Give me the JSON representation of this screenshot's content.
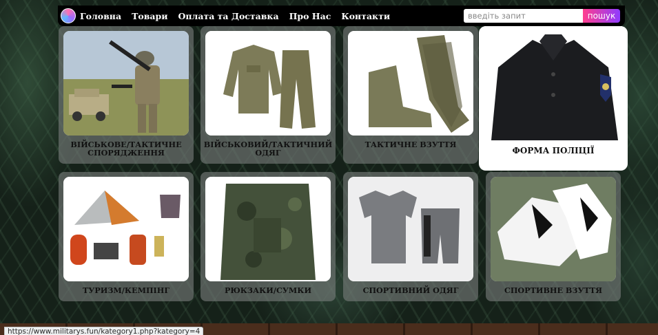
{
  "nav": {
    "links": [
      "Головна",
      "Товари",
      "Оплата та Доставка",
      "Про Нас",
      "Контакти"
    ],
    "search_placeholder": "введіть запит",
    "search_button": "пошук"
  },
  "categories": [
    {
      "title": "ВІЙСЬКОВЕ/ТАКТИЧНЕ СПОРЯДЖЕННЯ",
      "image": "soldier-with-rifle"
    },
    {
      "title": "ВІЙСЬКОВИЙ/ТАКТИЧНИЙ ОДЯГ",
      "image": "tactical-suit"
    },
    {
      "title": "ТАКТИЧНЕ ВЗУТТЯ",
      "image": "tactical-boots"
    },
    {
      "title": "ФОРМА ПОЛІЦІЇ",
      "image": "police-uniform"
    },
    {
      "title": "ТУРИЗМ/КЕМПІНГ",
      "image": "camping-gear"
    },
    {
      "title": "РЮКЗАКИ/СУМКИ",
      "image": "camo-backpack"
    },
    {
      "title": "СПОРТИВНИЙ ОДЯГ",
      "image": "sport-clothes"
    },
    {
      "title": "СПОРТИВНЕ ВЗУТТЯ",
      "image": "sneakers"
    }
  ],
  "colors": {
    "nav_bg": "#000000",
    "search_button_gradient": [
      "#ff3f8e",
      "#8f3cff"
    ],
    "card_bg": "rgba(120,125,122,0.62)"
  },
  "status_bar": {
    "url": "https://www.militarys.fun/kategory1.php?kategory=4"
  }
}
